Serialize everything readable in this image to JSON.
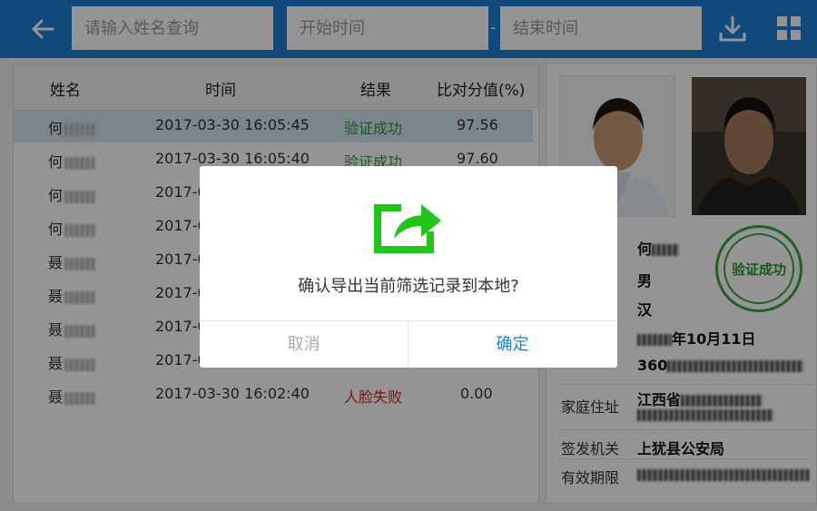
{
  "header": {
    "name_search_placeholder": "请输入姓名查询",
    "start_time_placeholder": "开始时间",
    "end_time_placeholder": "结束时间",
    "range_separator": "-"
  },
  "table": {
    "columns": [
      "姓名",
      "时间",
      "结果",
      "比对分值(%)"
    ],
    "rows": [
      {
        "name": "何",
        "time": "2017-03-30 16:05:45",
        "result": "验证成功",
        "score": "97.56",
        "status": "ok"
      },
      {
        "name": "何",
        "time": "2017-03-30 16:05:40",
        "result": "验证成功",
        "score": "97.60",
        "status": "ok"
      },
      {
        "name": "何",
        "time": "2017-0",
        "result": "",
        "score": "",
        "status": "ok"
      },
      {
        "name": "何",
        "time": "2017-0",
        "result": "",
        "score": "",
        "status": "ok"
      },
      {
        "name": "聂",
        "time": "2017-0",
        "result": "",
        "score": "",
        "status": "fail"
      },
      {
        "name": "聂",
        "time": "2017-0",
        "result": "",
        "score": "",
        "status": "fail"
      },
      {
        "name": "聂",
        "time": "2017-0",
        "result": "",
        "score": "",
        "status": "fail"
      },
      {
        "name": "聂",
        "time": "2017-0",
        "result": "",
        "score": "",
        "status": "fail"
      },
      {
        "name": "聂",
        "time": "2017-03-30 16:02:40",
        "result": "人脸失败",
        "score": "0.00",
        "status": "fail"
      }
    ]
  },
  "detail": {
    "stamp": "验证成功",
    "name": "何",
    "gender": "男",
    "ethnicity": "汉",
    "birth": "年10月11日",
    "id_prefix": "360",
    "address_label": "家庭住址",
    "address": "江西省",
    "authority_label": "签发机关",
    "authority": "上犹县公安局",
    "validity_label": "有效期限"
  },
  "dialog": {
    "message": "确认导出当前筛选记录到本地?",
    "cancel": "取消",
    "confirm": "确定"
  },
  "colors": {
    "primary": "#1f7fd6",
    "success": "#2f9a33",
    "fail": "#e02222",
    "export_icon": "#22c41c"
  },
  "icons": [
    "back-arrow-icon",
    "download-icon",
    "grid-icon",
    "export-share-icon"
  ]
}
